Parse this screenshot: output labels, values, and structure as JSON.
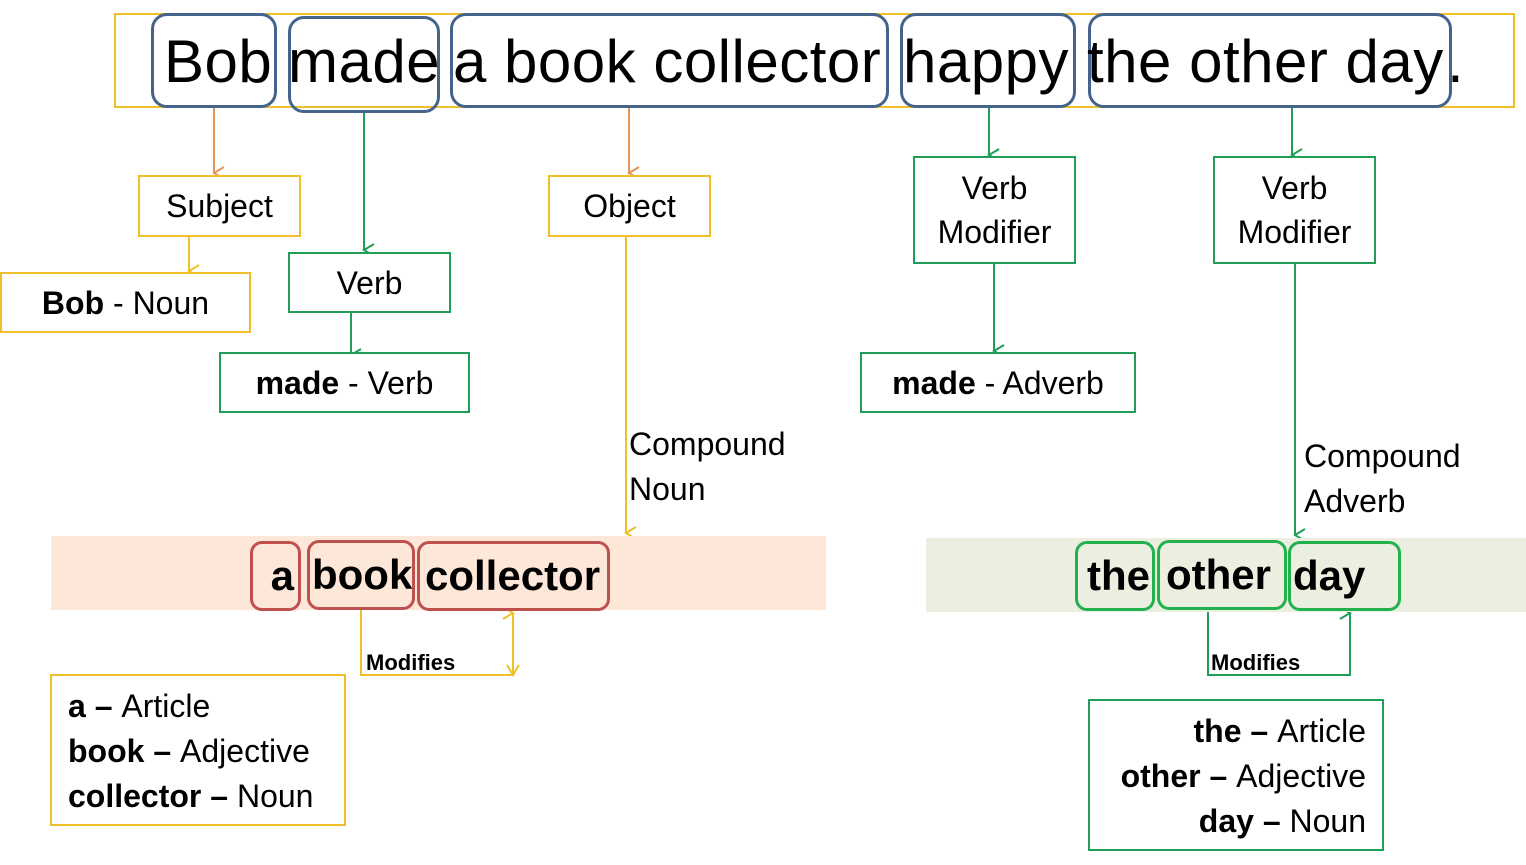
{
  "colors": {
    "frame_yellow": "#f0c02a",
    "chunk_blue": "#44648c",
    "arrow_orange": "#e3955a",
    "green": "#1e9e58",
    "chip_red": "#c0504d",
    "chip_green": "#22b14c",
    "band_peach": "#fde7d8",
    "band_sage": "#ebefe0"
  },
  "sentence": {
    "chunks": [
      "Bob",
      "made",
      "a book collector",
      "happy",
      "the other day"
    ],
    "punctuation": "."
  },
  "roles": {
    "subject": "Subject",
    "verb": "Verb",
    "object": "Object",
    "verb_modifier_1": [
      "Verb",
      "Modifier"
    ],
    "verb_modifier_2": [
      "Verb",
      "Modifier"
    ]
  },
  "pos": {
    "bob": {
      "word": "Bob",
      "sep": " - ",
      "tag": "Noun"
    },
    "made_verb": {
      "word": "made",
      "sep": " - ",
      "tag": "Verb"
    },
    "made_adverb": {
      "word": "made",
      "sep": " - ",
      "tag": "Adverb"
    }
  },
  "compound_labels": {
    "noun": [
      "Compound",
      "Noun"
    ],
    "adverb": [
      "Compound",
      "Adverb"
    ]
  },
  "noun_phrase": {
    "words": [
      "a",
      "book",
      "collector"
    ],
    "modifies_label": "Modifies",
    "legend": [
      {
        "word": "a",
        "sep": " – ",
        "tag": "Article"
      },
      {
        "word": "book",
        "sep": " – ",
        "tag": "Adjective"
      },
      {
        "word": "collector",
        "sep": " – ",
        "tag": "Noun"
      }
    ]
  },
  "adverb_phrase": {
    "words": [
      "the",
      "other",
      "day"
    ],
    "modifies_label": "Modifies",
    "legend": [
      {
        "word": "the",
        "sep": " – ",
        "tag": "Article"
      },
      {
        "word": "other",
        "sep": " – ",
        "tag": "Adjective"
      },
      {
        "word": "day",
        "sep": " – ",
        "tag": "Noun"
      }
    ]
  }
}
